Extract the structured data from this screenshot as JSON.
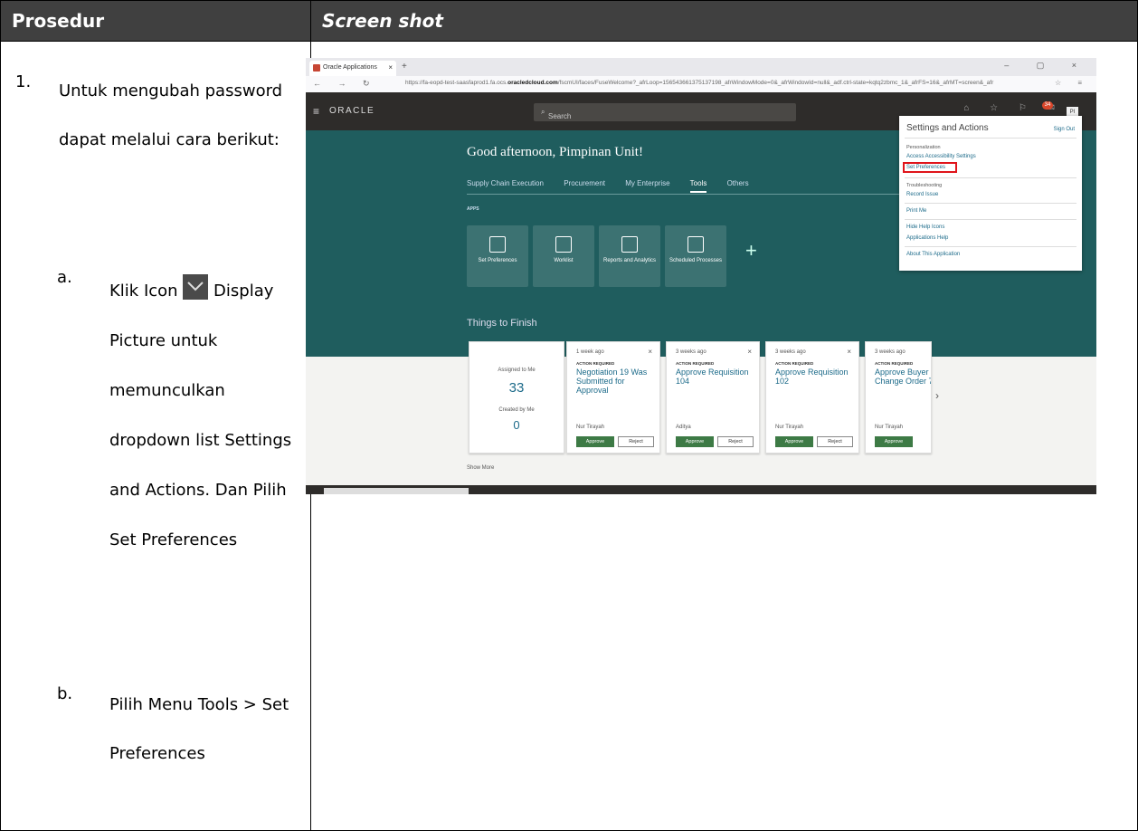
{
  "table": {
    "header_left": "Prosedur",
    "header_right": "Screen shot"
  },
  "step": {
    "number": "1.",
    "text": "Untuk mengubah password dapat melalui cara berikut:",
    "sub_a_letter": "a.",
    "sub_a_prefix": "Klik Icon",
    "sub_a_icon": "chevron-down-icon",
    "sub_a_rest": "Display Picture untuk memunculkan dropdown list Settings and Actions. Dan Pilih Set Preferences",
    "sub_b_letter": "b.",
    "sub_b_text": "Pilih Menu Tools > Set Preferences"
  },
  "screenshot": {
    "tab_title": "Oracle Applications",
    "url_pre": "https://fa-eopd-test-saasfaprod1.fa.ocs.",
    "url_domain": "oracledcloud.com",
    "url_post": "/fscmUI/faces/FuseWelcome?_afrLoop=156543661375137198_afrWindowMode=0&_afrWindowId=null&_adf.ctrl-state=kqtq2zbmc_1&_afrFS=16&_afrMT=screen&_afr",
    "logo": "ORACLE",
    "search_placeholder": "Search",
    "notif_count": "34",
    "avatar_initials": "PI",
    "welcome": "Good afternoon, Pimpinan Unit!",
    "nav_tabs": [
      "Supply Chain Execution",
      "Procurement",
      "My Enterprise",
      "Tools",
      "Others"
    ],
    "apps_label": "APPS",
    "apps": [
      "Set Preferences",
      "Worklist",
      "Reports and Analytics",
      "Scheduled Processes"
    ],
    "things_title": "Things to Finish",
    "assigned_label": "Assigned to Me",
    "assigned_count": "33",
    "created_label": "Created by Me",
    "created_count": "0",
    "tasks": [
      {
        "when": "1 week ago",
        "title": "Negotiation 19 Was Submitted for Approval",
        "who": "Nur Tirayah"
      },
      {
        "when": "3 weeks ago",
        "title": "Approve Requisition 104",
        "who": "Aditya"
      },
      {
        "when": "3 weeks ago",
        "title": "Approve Requisition 102",
        "who": "Nur Tirayah"
      },
      {
        "when": "3 weeks ago",
        "title": "Approve Buyer Change Order 7",
        "who": "Nur Tirayah"
      }
    ],
    "action_required": "ACTION REQUIRED",
    "approve": "Approve",
    "reject": "Reject",
    "show_more": "Show More",
    "dropdown": {
      "title": "Settings and Actions",
      "sign_out": "Sign Out",
      "sec_personalization": "Personalization",
      "item_access": "Access Accessibility Settings",
      "item_prefs": "Set Preferences",
      "sec_trouble": "Troubleshooting",
      "item_record": "Record Issue",
      "item_print": "Print Me",
      "item_hide": "Hide Help Icons",
      "item_help": "Applications Help",
      "item_about": "About This Application"
    }
  }
}
